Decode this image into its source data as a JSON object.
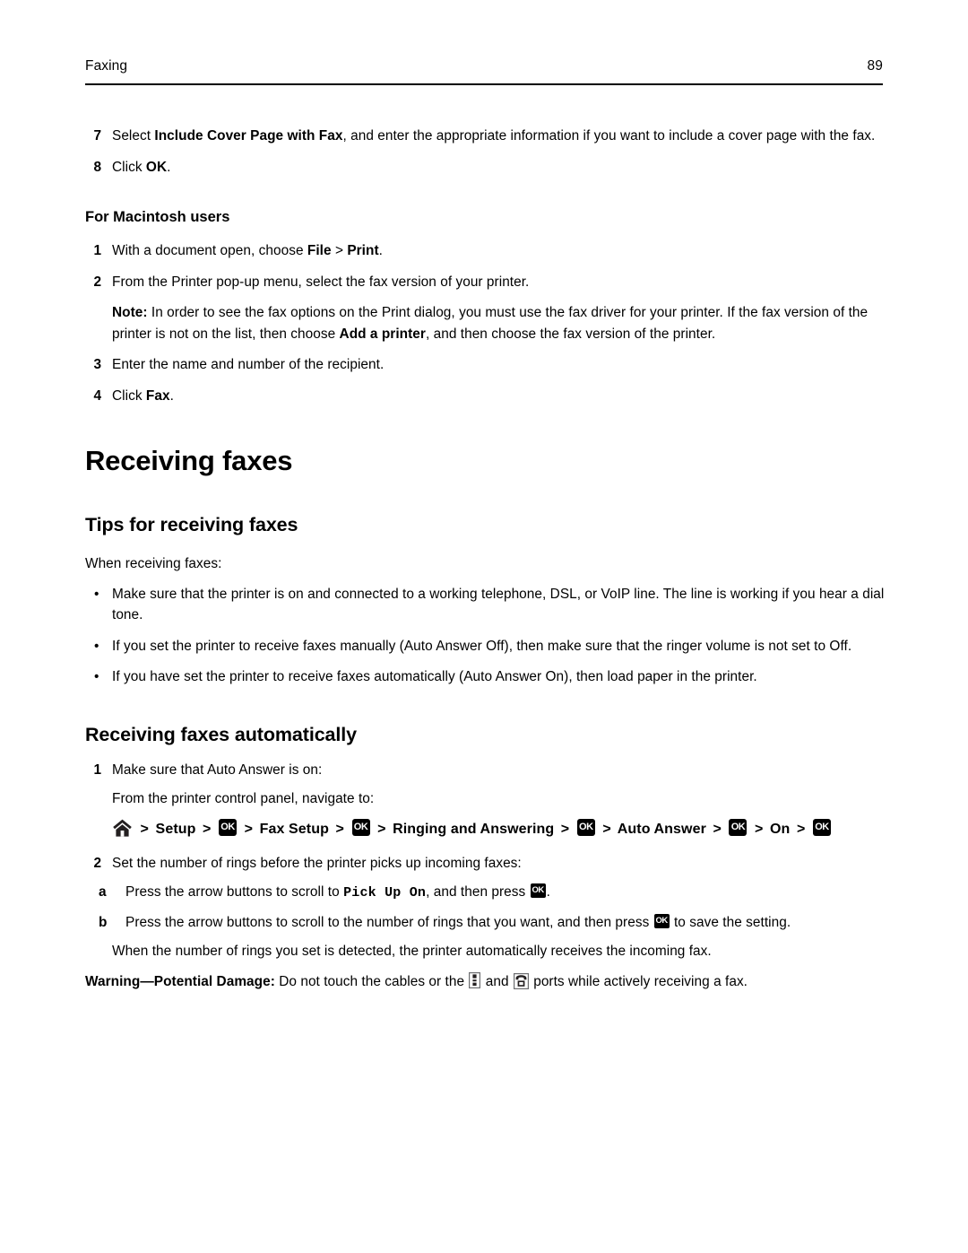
{
  "header": {
    "title": "Faxing",
    "page_number": "89"
  },
  "steps_top": [
    {
      "marker": "7",
      "parts": [
        {
          "t": "Select ",
          "b": false
        },
        {
          "t": "Include Cover Page with Fax",
          "b": true
        },
        {
          "t": ", and enter the appropriate information if you want to include a cover page with the fax.",
          "b": false
        }
      ]
    },
    {
      "marker": "8",
      "parts": [
        {
          "t": "Click ",
          "b": false
        },
        {
          "t": "OK",
          "b": true
        },
        {
          "t": ".",
          "b": false
        }
      ]
    }
  ],
  "macintosh": {
    "heading": "For Macintosh users",
    "steps": [
      {
        "marker": "1",
        "parts": [
          {
            "t": "With a document open, choose ",
            "b": false
          },
          {
            "t": "File",
            "b": true
          },
          {
            "t": " > ",
            "b": false
          },
          {
            "t": "Print",
            "b": true
          },
          {
            "t": ".",
            "b": false
          }
        ]
      },
      {
        "marker": "2",
        "parts": [
          {
            "t": "From the Printer pop-up menu, select the fax version of your printer.",
            "b": false
          }
        ]
      },
      {
        "marker": "3",
        "parts": [
          {
            "t": "Enter the name and number of the recipient.",
            "b": false
          }
        ]
      },
      {
        "marker": "4",
        "parts": [
          {
            "t": "Click ",
            "b": false
          },
          {
            "t": "Fax",
            "b": true
          },
          {
            "t": ".",
            "b": false
          }
        ]
      }
    ],
    "note": {
      "label": "Note:",
      "parts": [
        {
          "t": " In order to see the fax options on the Print dialog, you must use the fax driver for your printer. If the fax version of the printer is not on the list, then choose ",
          "b": false
        },
        {
          "t": "Add a printer",
          "b": true
        },
        {
          "t": ", and then choose the fax version of the printer.",
          "b": false
        }
      ]
    }
  },
  "receiving_faxes": {
    "h1": "Receiving faxes",
    "tips": {
      "h2": "Tips for receiving faxes",
      "intro": "When receiving faxes:",
      "bullets": [
        "Make sure that the printer is on and connected to a working telephone, DSL, or VoIP line. The line is working if you hear a dial tone.",
        "If you set the printer to receive faxes manually (Auto Answer Off), then make sure that the ringer volume is not set to Off.",
        "If you have set the printer to receive faxes automatically (Auto Answer On), then load paper in the printer."
      ]
    },
    "automatically": {
      "h2": "Receiving faxes automatically",
      "step1": {
        "marker": "1",
        "text": "Make sure that Auto Answer is on:",
        "cont": "From the printer control panel, navigate to:",
        "nav_path": {
          "home_icon": "home-icon",
          "separator": ">",
          "ok_label": "OK",
          "items": [
            "Setup",
            "Fax Setup",
            "Ringing and Answering",
            "Auto Answer",
            "On"
          ]
        }
      },
      "step2": {
        "marker": "2",
        "text": "Set the number of rings before the printer picks up incoming faxes:",
        "substeps": [
          {
            "marker": "a",
            "pre": "Press the arrow buttons to scroll to ",
            "mono": "Pick Up On",
            "mid": ", and then press ",
            "ok_label": "OK",
            "post": "."
          },
          {
            "marker": "b",
            "pre": "Press the arrow buttons to scroll to the number of rings that you want, and then press ",
            "mono": "",
            "mid": "",
            "ok_label": "OK",
            "post": " to save the setting."
          }
        ],
        "cont": "When the number of rings you set is detected, the printer automatically receives the incoming fax."
      },
      "warning": {
        "label": "Warning—Potential Damage:",
        "part1": " Do not touch the cables or the ",
        "line_port_icon": "line-port-icon",
        "part2": " and ",
        "ext_port_icon": "ext-phone-port-icon",
        "part3": " ports while actively receiving a fax."
      }
    }
  }
}
